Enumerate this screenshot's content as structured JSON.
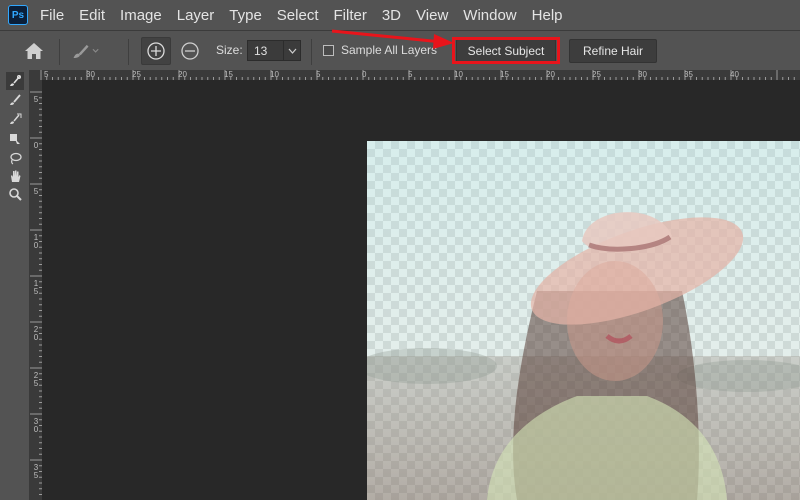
{
  "app": {
    "logo_text": "Ps",
    "accent_color": "#31a8ff"
  },
  "menu": {
    "items": [
      "File",
      "Edit",
      "Image",
      "Layer",
      "Type",
      "Select",
      "Filter",
      "3D",
      "View",
      "Window",
      "Help"
    ]
  },
  "options_bar": {
    "size_label": "Size:",
    "size_value": "13",
    "sample_all_layers_label": "Sample All Layers",
    "sample_all_layers_checked": false,
    "select_subject_label": "Select Subject",
    "refine_hair_label": "Refine Hair",
    "highlight_color": "#e8141b",
    "icons": [
      "home-icon",
      "quick-selection-brush-icon",
      "add-to-selection-icon",
      "subtract-from-selection-icon"
    ]
  },
  "rulers": {
    "horizontal_labels": [
      "5",
      "30",
      "25",
      "20",
      "15",
      "10",
      "5",
      "0",
      "5",
      "10",
      "15",
      "20",
      "25",
      "30",
      "35",
      "40"
    ],
    "vertical_labels": [
      "5",
      "0",
      "5",
      "10",
      "15",
      "20",
      "25",
      "30",
      "35"
    ]
  },
  "toolbox": {
    "tools": [
      "quick-selection-icon",
      "brush-icon",
      "object-selection-icon",
      "refine-edge-icon",
      "lasso-icon",
      "hand-icon",
      "zoom-icon"
    ]
  }
}
